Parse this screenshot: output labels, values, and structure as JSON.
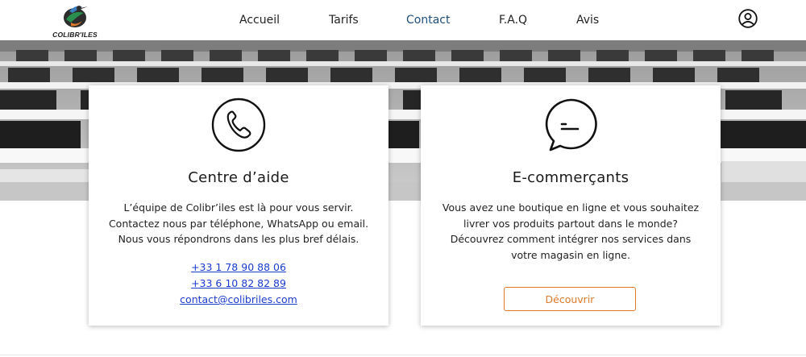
{
  "header": {
    "logo_text": "COLIBR'ILES",
    "nav": [
      {
        "label": "Accueil"
      },
      {
        "label": "Tarifs"
      },
      {
        "label": "Contact"
      },
      {
        "label": "F.A.Q"
      },
      {
        "label": "Avis"
      }
    ],
    "active_nav": "Contact",
    "user_icon": "user-circle-icon"
  },
  "hero": {
    "image": "office-computers-grayscale"
  },
  "help_card": {
    "icon": "phone-icon",
    "title": "Centre d’aide",
    "lines": [
      "L’équipe de Colibr’iles est là pour vous servir.",
      "Contactez nous par téléphone, WhatsApp ou email.",
      "Nous vous répondrons dans les plus bref délais."
    ],
    "phone1": "+33 1 78 90 88 06",
    "phone2": "+33 6 10 82 82 89",
    "email": "contact@colibriles.com"
  },
  "ecom_card": {
    "icon": "chat-bubble-icon",
    "title": "E-commerçants",
    "lines": [
      "Vous avez une boutique en ligne et vous souhaitez",
      "livrer vos produits partout dans le monde?",
      "Découvrez comment intégrer nos services dans",
      "votre magasin en ligne."
    ],
    "button_label": "Découvrir"
  },
  "colors": {
    "accent_orange": "#e07a2b",
    "link_blue": "#1a3ccf",
    "nav_active": "#1f4f7a"
  }
}
